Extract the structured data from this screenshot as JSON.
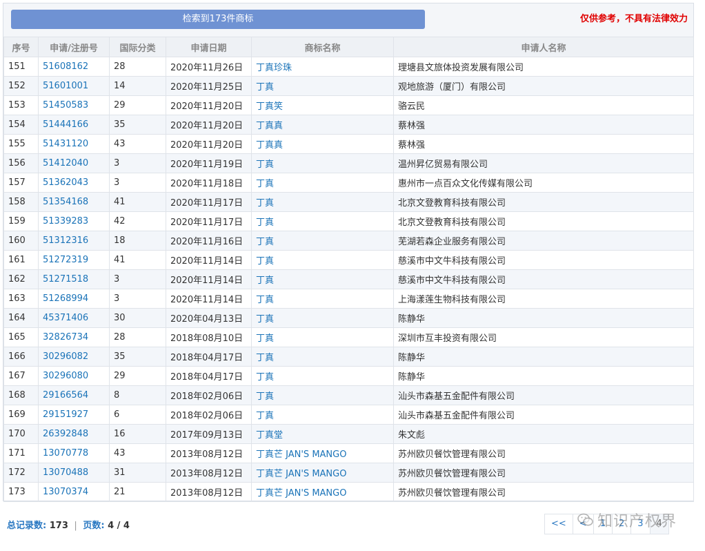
{
  "header": {
    "result_label": "检索到173件商标",
    "disclaimer": "仅供参考，不具有法律效力"
  },
  "columns": [
    "序号",
    "申请/注册号",
    "国际分类",
    "申请日期",
    "商标名称",
    "申请人名称"
  ],
  "rows": [
    [
      "151",
      "51608162",
      "28",
      "2020年11月26日",
      "丁真珍珠",
      "理塘县文旅体投资发展有限公司"
    ],
    [
      "152",
      "51601001",
      "14",
      "2020年11月25日",
      "丁真",
      "观地旅游（厦门）有限公司"
    ],
    [
      "153",
      "51450583",
      "29",
      "2020年11月20日",
      "丁真笑",
      "骆云民"
    ],
    [
      "154",
      "51444166",
      "35",
      "2020年11月20日",
      "丁真真",
      "蔡林强"
    ],
    [
      "155",
      "51431120",
      "43",
      "2020年11月20日",
      "丁真真",
      "蔡林强"
    ],
    [
      "156",
      "51412040",
      "3",
      "2020年11月19日",
      "丁真",
      "温州昇亿贸易有限公司"
    ],
    [
      "157",
      "51362043",
      "3",
      "2020年11月18日",
      "丁真",
      "惠州市一点百众文化传媒有限公司"
    ],
    [
      "158",
      "51354168",
      "41",
      "2020年11月17日",
      "丁真",
      "北京文登教育科技有限公司"
    ],
    [
      "159",
      "51339283",
      "42",
      "2020年11月17日",
      "丁真",
      "北京文登教育科技有限公司"
    ],
    [
      "160",
      "51312316",
      "18",
      "2020年11月16日",
      "丁真",
      "芜湖若森企业服务有限公司"
    ],
    [
      "161",
      "51272319",
      "41",
      "2020年11月14日",
      "丁真",
      "慈溪市中文牛科技有限公司"
    ],
    [
      "162",
      "51271518",
      "3",
      "2020年11月14日",
      "丁真",
      "慈溪市中文牛科技有限公司"
    ],
    [
      "163",
      "51268994",
      "3",
      "2020年11月14日",
      "丁真",
      "上海漾莲生物科技有限公司"
    ],
    [
      "164",
      "45371406",
      "30",
      "2020年04月13日",
      "丁真",
      "陈静华"
    ],
    [
      "165",
      "32826734",
      "28",
      "2018年08月10日",
      "丁真",
      "深圳市互丰投资有限公司"
    ],
    [
      "166",
      "30296082",
      "35",
      "2018年04月17日",
      "丁真",
      "陈静华"
    ],
    [
      "167",
      "30296080",
      "29",
      "2018年04月17日",
      "丁真",
      "陈静华"
    ],
    [
      "168",
      "29166564",
      "8",
      "2018年02月06日",
      "丁真",
      "汕头市森基五金配件有限公司"
    ],
    [
      "169",
      "29151927",
      "6",
      "2018年02月06日",
      "丁真",
      "汕头市森基五金配件有限公司"
    ],
    [
      "170",
      "26392848",
      "16",
      "2017年09月13日",
      "丁真堂",
      "朱文彪"
    ],
    [
      "171",
      "13070778",
      "43",
      "2013年08月12日",
      "丁真芒 JAN'S MANGO",
      "苏州欧贝餐饮管理有限公司"
    ],
    [
      "172",
      "13070488",
      "31",
      "2013年08月12日",
      "丁真芒 JAN'S MANGO",
      "苏州欧贝餐饮管理有限公司"
    ],
    [
      "173",
      "13070374",
      "21",
      "2013年08月12日",
      "丁真芒 JAN'S MANGO",
      "苏州欧贝餐饮管理有限公司"
    ]
  ],
  "footer": {
    "total_label": "总记录数:",
    "total_value": "173",
    "separator": "|",
    "pages_label": "页数:",
    "pages_value": "4 / 4"
  },
  "pagination": [
    "<<",
    "<",
    "1",
    "2",
    "3",
    "4"
  ],
  "watermark": "知识产权界"
}
